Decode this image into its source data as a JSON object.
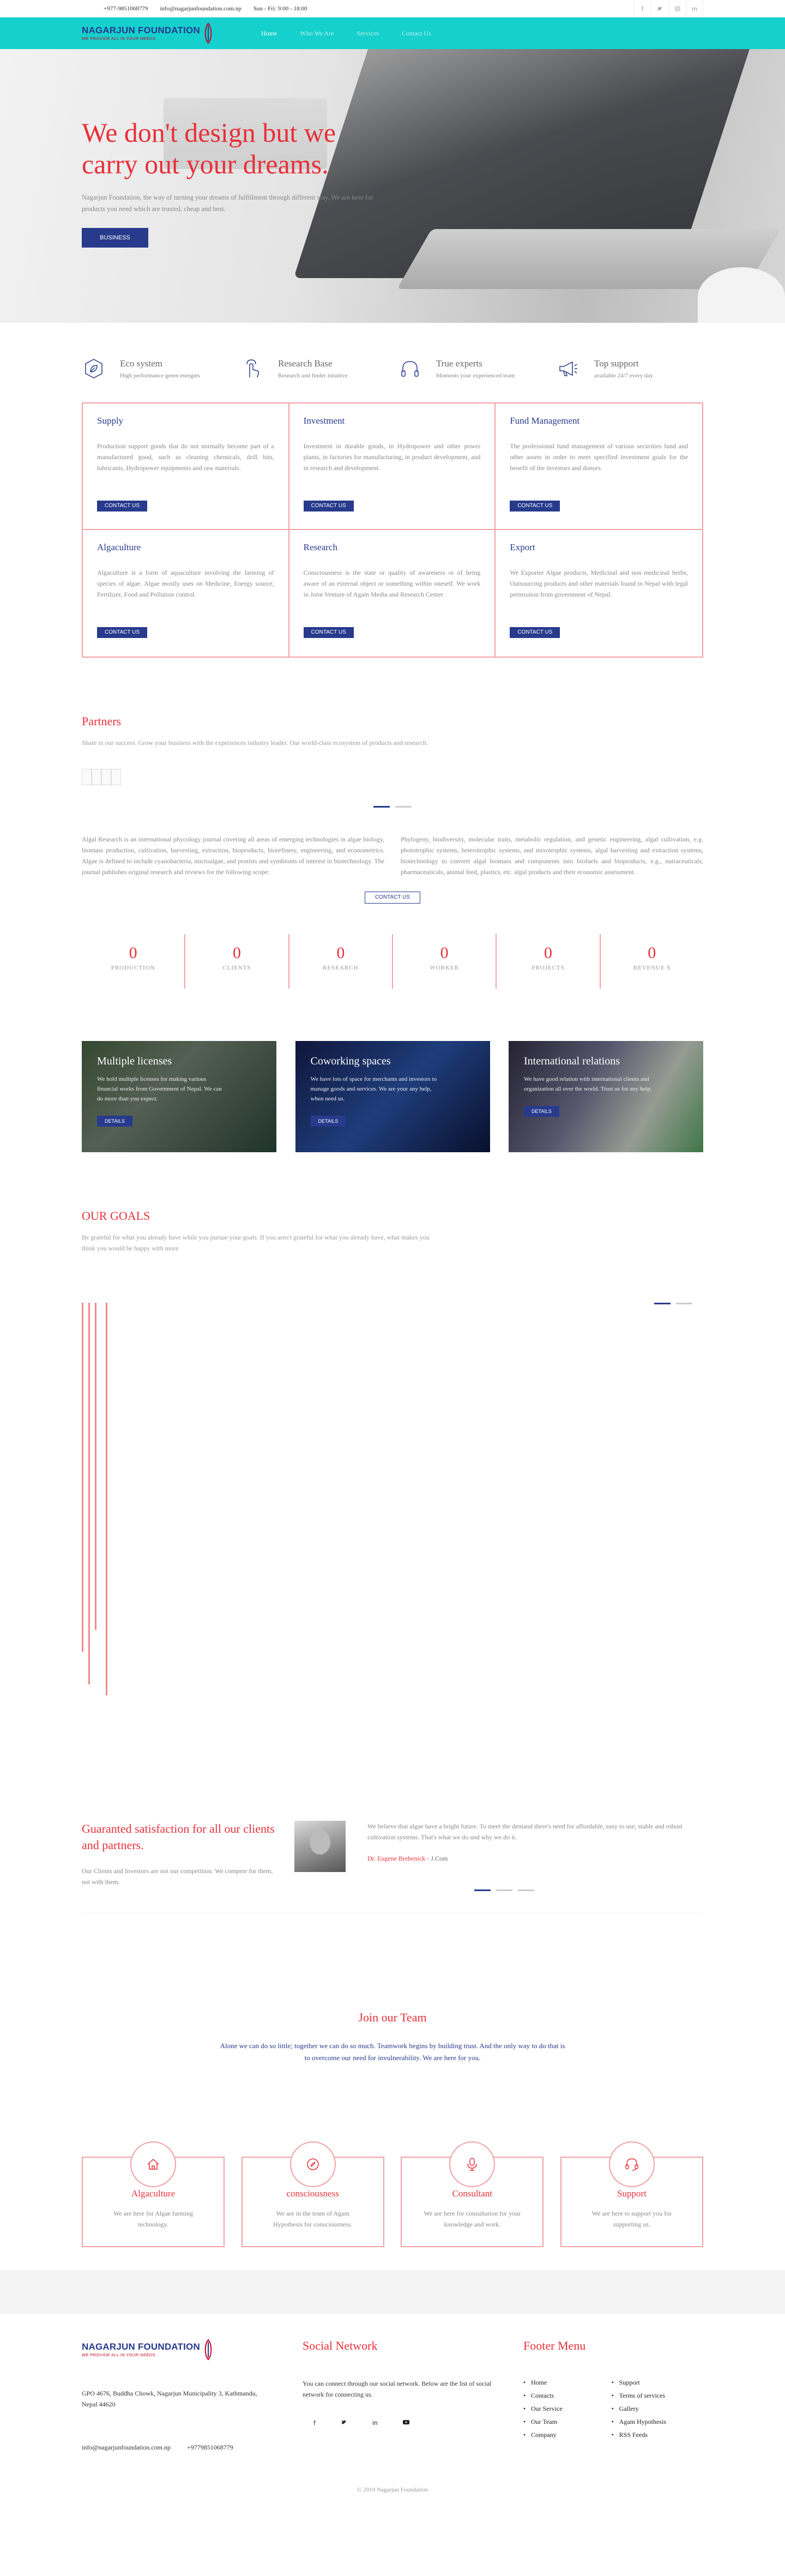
{
  "topbar": {
    "phone": "+977-9851068779",
    "email": "info@nagarjunfoundation.com.np",
    "hours": "Sun - Fri: 9:00 - 18:00",
    "socials": [
      "facebook-icon",
      "twitter-icon",
      "instagram-icon",
      "linkedin-icon"
    ]
  },
  "brand": {
    "name": "NAGARJUN FOUNDATION",
    "tagline": "WE PROVIDE ALL IN YOUR NEEDS"
  },
  "nav": {
    "items": [
      "Home",
      "Who We Are",
      "Services",
      "Contact Us"
    ],
    "active": 0
  },
  "hero": {
    "title": "We don't design but we carry out your dreams.",
    "text": "Nagarjun Foundation, the way of turning your dreams of fulfillment through different way. We are here for products you need which are trusted, cheap and best.",
    "button": "BUSINESS"
  },
  "features": [
    {
      "title": "Eco system",
      "text": "High performance green energies",
      "icon": "leaf-icon"
    },
    {
      "title": "Research Base",
      "text": "Research and finder intuitive",
      "icon": "touch-icon"
    },
    {
      "title": "True experts",
      "text": "Moments your experienced team",
      "icon": "headphones-icon"
    },
    {
      "title": "Top support",
      "text": "available 24/7 every day",
      "icon": "megaphone-icon"
    }
  ],
  "services": [
    {
      "title": "Supply",
      "text": "Production support goods that do not normally become part of a manufactured good, such as cleaning chemicals, drill bits, lubricants, Hydropower equipments and raw materials.",
      "button": "CONTACT US"
    },
    {
      "title": "Investment",
      "text": "Investment in durable goods, in Hydropower and other power plants, in factories for manufacturing, in product development, and in research and development.",
      "button": "CONTACT US"
    },
    {
      "title": "Fund Management",
      "text": "The professional fund management of various securities fund and other assets in order to meet specified investment goals for the benefit of the investors and donors.",
      "button": "CONTACT US"
    },
    {
      "title": "Algaculture",
      "text": "Algaculture is a form of aquaculture involving the farming of species of algae. Algae mostly uses on Medicine, Energy source, Fertilizer, Food and Pollution control.",
      "button": "CONTACT US"
    },
    {
      "title": "Research",
      "text": "Consciousness is the state or quality of awareness or of being aware of an external object or something within oneself. We work in Joint Venture of Agam Media and Research Center",
      "button": "CONTACT US"
    },
    {
      "title": "Export",
      "text": "We Exporter Algae products, Medicinal and non medicinal herbs, Outsourcing products and other materials found in Nepal with legal permission from government of Nepal.",
      "button": "CONTACT US"
    }
  ],
  "partners": {
    "title": "Partners",
    "lead": "Share in our success. Grow your business with the experiences industry leader. Our world-class ecosystem of products and research."
  },
  "about": {
    "left": "Algal Research is an international phycology journal covering all areas of emerging technologies in algae biology, biomass production, cultivation, harvesting, extraction, bioproducts, biorefinery, engineering, and econometrics. Algae is defined to include cyanobacteria, microalgae, and protists and symbionts of interest in biotechnology. The journal publishes original research and reviews for the following scope:",
    "right": "Phylogeny, biodiversity, molecular traits, metabolic regulation, and genetic engineering, algal cultivation, e.g. phototrophic systems, heterotrophic systems, and mixotrophic systems, algal harvesting and extraction systems, biotechnology to convert algal biomass and components into biofuels and bioproducts, e.g., nutraceuticals, pharmaceuticals, animal feed, plastics, etc. algal products and their economic assessment.",
    "button": "CONTACT US"
  },
  "counters": [
    {
      "value": "0",
      "label": "PRODUCTION"
    },
    {
      "value": "0",
      "label": "CLIENTS"
    },
    {
      "value": "0",
      "label": "RESEARCH"
    },
    {
      "value": "0",
      "label": "WORKER"
    },
    {
      "value": "0",
      "label": "PROJECTS"
    },
    {
      "value": "0",
      "label": "REVENUE $"
    }
  ],
  "cards": [
    {
      "title": "Multiple licenses",
      "text": "We hold multiple licenses for making various financial works from Government of Nepal. We can do more than you expect.",
      "button": "DETAILS"
    },
    {
      "title": "Coworking spaces",
      "text": "We have lots of space for merchants and investors to manage goods and services. We are your any help, when need us.",
      "button": "DETAILS"
    },
    {
      "title": "International relations",
      "text": "We have good relation with international clients and organization all over the world. Trust us for any help.",
      "button": "DETAILS"
    }
  ],
  "goals": {
    "title": "OUR GOALS",
    "lead": "Be grateful for what you already have while you pursue your goals. If you aren't grateful for what you already have, what makes you think you would be happy with more."
  },
  "testimonial": {
    "heading": "Guaranted satisfaction for all our clients and partners.",
    "text": "Our Clients and Investors are not our competition. We compete for them, not with them.",
    "quote": "We believe that algae have a bright future. To meet the demand there's need for affordable, easy to use, stable and robust cultivation systems. That's what we do and why we do it.",
    "author": "Dr. Eugene Brebenick",
    "company": "J.Com"
  },
  "team": {
    "title": "Join our Team",
    "text": "Alone we can do so little; together we can do so much. Teamwork begins by building trust. And the only way to do that is to overcome our need for invulnerability. We are here for you."
  },
  "team_cards": [
    {
      "title": "Algaculture",
      "text": "We are here for Algae farming technology.",
      "icon": "home-icon"
    },
    {
      "title": "consciousness",
      "text": "We are in the team of Agam Hypothesis for consciousness.",
      "icon": "compass-icon"
    },
    {
      "title": "Consultant",
      "text": "We are here for consultation for your knowledge and work.",
      "icon": "microphone-icon"
    },
    {
      "title": "Support",
      "text": "We are here to support you for supporting us.",
      "icon": "headset-icon"
    }
  ],
  "footer": {
    "address": "GPO 4676, Buddha Chowk, Nagarjun Municipality 3, Kathmandu, Nepal 44620",
    "email": "info@nagarjunfoundation.com.np",
    "phone": "+9779851068779",
    "social_title": "Social Network",
    "social_text": "You can connect through our social network. Below are the list of social network for connecting us.",
    "menu_title": "Footer Menu",
    "menu_left": [
      "Home",
      "Contacts",
      "Our Service",
      "Our Team",
      "Company"
    ],
    "menu_right": [
      "Support",
      "Terms of services",
      "Gallery",
      "Agam Hypothesis",
      "RSS Feeds"
    ],
    "copyright": "© 2019 Nagarjun Foundation"
  },
  "colors": {
    "accent": "#e8303a",
    "brand": "#273a8c",
    "nav": "#15d0cc",
    "border": "#f2a2a5"
  }
}
